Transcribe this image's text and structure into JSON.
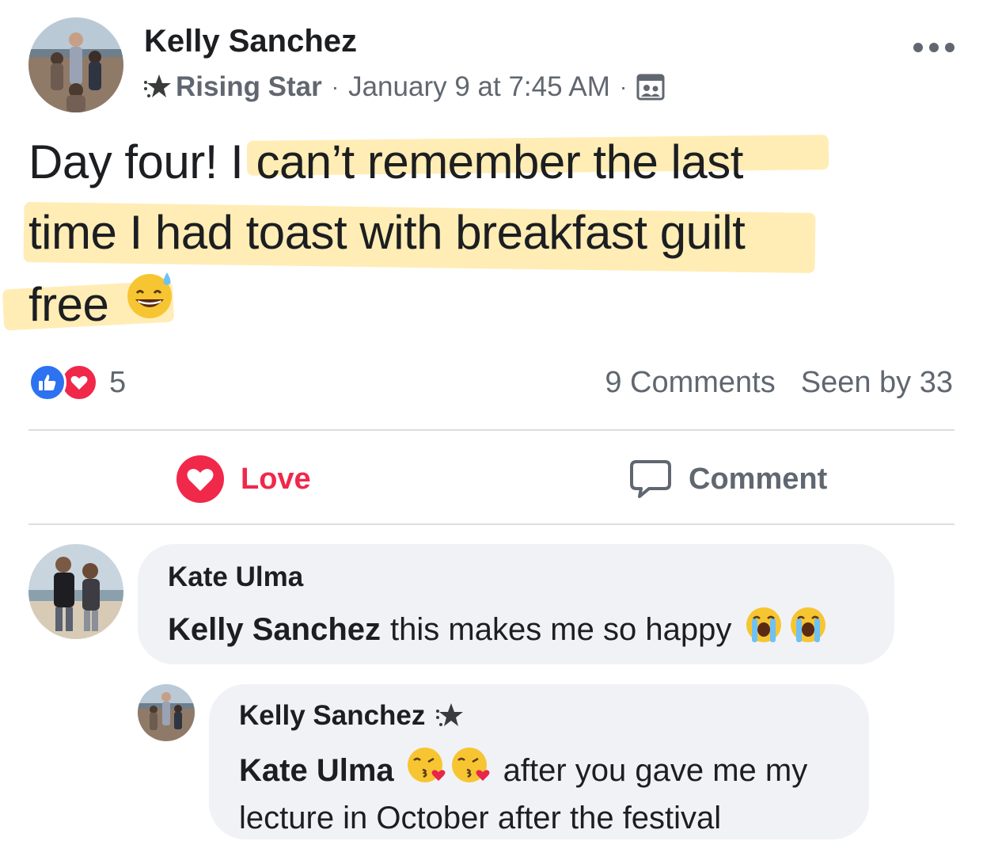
{
  "post": {
    "author": "Kelly Sanchez",
    "badge": "Rising Star",
    "timestamp": "January 9 at 7:45 AM",
    "audience_icon": "group-members-icon",
    "text_lines": [
      "Day four! I can’t remember the last",
      "time I had toast with breakfast guilt",
      "free"
    ],
    "reactions": {
      "types": [
        "like",
        "love"
      ],
      "count": "5"
    },
    "comments_count": "9 Comments",
    "seen_by": "Seen by 33"
  },
  "actions": {
    "love_label": "Love",
    "comment_label": "Comment"
  },
  "comments": [
    {
      "author": "Kate Ulma",
      "mention": "Kelly Sanchez",
      "text": "this makes me so happy",
      "emojis": [
        "loudly-crying-face",
        "loudly-crying-face"
      ]
    },
    {
      "author": "Kelly Sanchez",
      "badge_icon": "rising-star-icon",
      "mention": "Kate Ulma",
      "emojis": [
        "face-blowing-kiss",
        "face-blowing-kiss"
      ],
      "text_line1": "after you gave me my",
      "text_line2": "lecture in October after the festival"
    }
  ],
  "colors": {
    "text_primary": "#1c1e21",
    "text_secondary": "#606770",
    "love_red": "#f0284a",
    "like_blue": "#2d72f0",
    "bubble_bg": "#f0f2f5",
    "highlight": "#ffde78"
  }
}
